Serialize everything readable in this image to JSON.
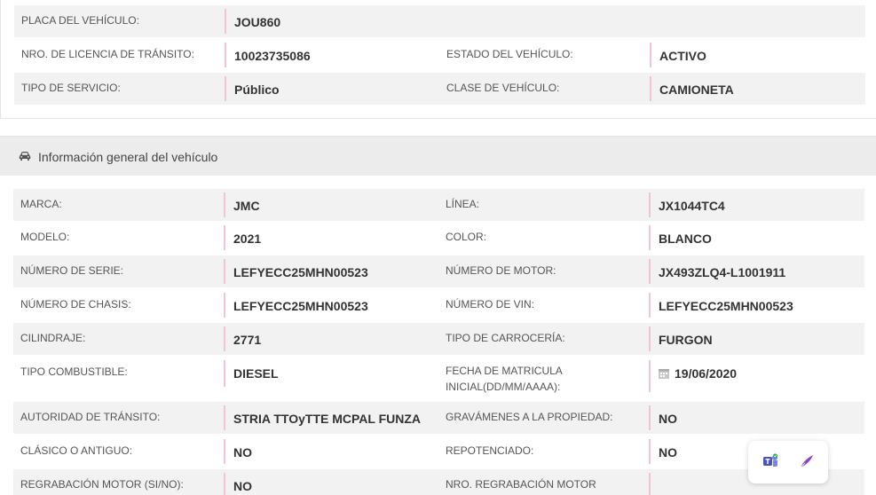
{
  "top_rows": [
    {
      "label1": "PLACA DEL VEHÍCULO:",
      "value1": "JOU860",
      "label2": "",
      "value2": ""
    },
    {
      "label1": "NRO. DE LICENCIA DE TRÁNSITO:",
      "value1": "10023735086",
      "label2": "ESTADO DEL VEHÍCULO:",
      "value2": "ACTIVO"
    },
    {
      "label1": "TIPO DE SERVICIO:",
      "value1": "Público",
      "label2": "CLASE DE VEHÍCULO:",
      "value2": "CAMIONETA"
    }
  ],
  "section": {
    "title": "Información general del vehículo",
    "icon": "car-icon"
  },
  "rows": [
    {
      "label1": "MARCA:",
      "value1": "JMC",
      "label2": "LÍNEA:",
      "value2": "JX1044TC4"
    },
    {
      "label1": "MODELO:",
      "value1": "2021",
      "label2": "COLOR:",
      "value2": "BLANCO"
    },
    {
      "label1": "NÚMERO DE SERIE:",
      "value1": "LEFYECC25MHN00523",
      "label2": "NÚMERO DE MOTOR:",
      "value2": "JX493ZLQ4-L1001911"
    },
    {
      "label1": "NÚMERO DE CHASIS:",
      "value1": "LEFYECC25MHN00523",
      "label2": "NÚMERO DE VIN:",
      "value2": "LEFYECC25MHN00523"
    },
    {
      "label1": "CILINDRAJE:",
      "value1": "2771",
      "label2": "TIPO DE CARROCERÍA:",
      "value2": "FURGON"
    },
    {
      "label1": "TIPO COMBUSTIBLE:",
      "value1": "DIESEL",
      "label2a": "FECHA DE MATRICULA",
      "label2b": "INICIAL(DD/MM/AAAA):",
      "value2": "19/06/2020"
    },
    {
      "label1": "AUTORIDAD DE TRÁNSITO:",
      "value1": "STRIA TTOyTTE MCPAL FUNZA",
      "label2": "GRAVÁMENES A LA PROPIEDAD:",
      "value2": "NO"
    },
    {
      "label1": "CLÁSICO O ANTIGUO:",
      "value1": "NO",
      "label2": "REPOTENCIADO:",
      "value2": "NO"
    },
    {
      "label1": "REGRABACIÓN MOTOR (SI/NO):",
      "value1": "NO",
      "label2": "NRO. REGRABACIÓN MOTOR",
      "value2": ""
    }
  ],
  "colors": {
    "separator": "#f1c5cf",
    "row_shade": "#f2f2f2",
    "header_bg": "#ececec",
    "feather": "#8e44c9",
    "teams": "#4b53bc"
  }
}
